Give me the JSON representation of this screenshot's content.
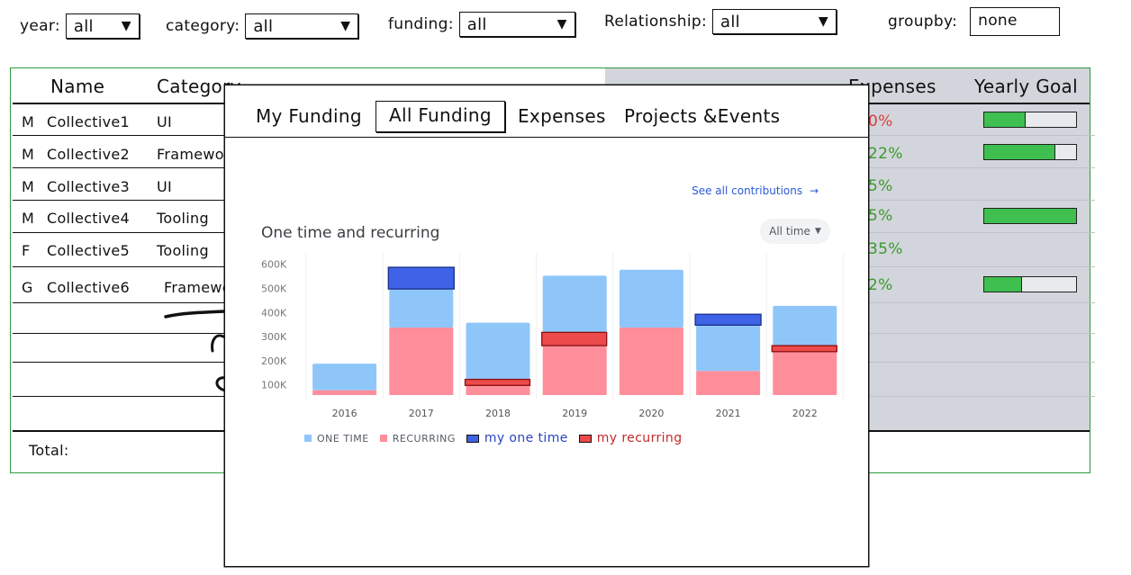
{
  "filters": [
    {
      "label": "year:",
      "value": "all"
    },
    {
      "label": "category:",
      "value": "all"
    },
    {
      "label": "funding:",
      "value": "all"
    },
    {
      "label": "Relationship:",
      "value": "all"
    }
  ],
  "groupby": {
    "label": "groupby:",
    "value": "none"
  },
  "table": {
    "headers": {
      "name": "Name",
      "category": "Category",
      "expenses": "Expenses",
      "yearly_goal": "Yearly Goal"
    },
    "rows": [
      {
        "prefix": "M",
        "name": "Collective1",
        "category": "UI",
        "expenses_pct": "0%",
        "goal": 0.45
      },
      {
        "prefix": "M",
        "name": "Collective2",
        "category": "Framework",
        "expenses_pct": "22%",
        "goal": 0.77
      },
      {
        "prefix": "M",
        "name": "Collective3",
        "category": "UI",
        "expenses_pct": "5%",
        "goal": null
      },
      {
        "prefix": "M",
        "name": "Collective4",
        "category": "Tooling",
        "expenses_pct": "5%",
        "goal": 1.0
      },
      {
        "prefix": "F",
        "name": "Collective5",
        "category": "Tooling",
        "expenses_pct": "35%",
        "goal": null
      },
      {
        "prefix": "G",
        "name": "Collective6",
        "category": "Framework",
        "expenses_pct": "2%",
        "goal": 0.41
      }
    ],
    "total_label": "Total:"
  },
  "modal": {
    "tabs": [
      "My Funding",
      "All Funding",
      "Expenses",
      "Projects &Events"
    ],
    "active_tab": "All Funding",
    "see_all_link": "See all contributions",
    "chart_title": "One time and recurring",
    "time_filter": "All time"
  },
  "colors": {
    "one_time": "#8fc6fa",
    "recurring": "#ff8e9b",
    "my_one_time": "#3f63e6",
    "my_recurring": "#ec4a4a",
    "progress": "#3fbf4f",
    "link": "#2b5bd6",
    "red_pct": "#e03a3a",
    "green_pct": "#3a9a2a"
  },
  "chart_data": {
    "type": "bar",
    "title": "One time and recurring",
    "categories": [
      "2016",
      "2017",
      "2018",
      "2019",
      "2020",
      "2021",
      "2022"
    ],
    "y_ticks": [
      "100K",
      "200K",
      "300K",
      "400K",
      "500K",
      "600K"
    ],
    "ylim": [
      50000,
      610000
    ],
    "series": [
      {
        "name": "ONE TIME",
        "values": [
          110000,
          160000,
          235000,
          235000,
          240000,
          235000,
          165000
        ]
      },
      {
        "name": "RECURRING",
        "values": [
          20000,
          280000,
          65000,
          260000,
          280000,
          100000,
          205000
        ]
      },
      {
        "name": "my one time",
        "values": [
          0,
          90000,
          0,
          0,
          0,
          45000,
          0
        ]
      },
      {
        "name": "my recurring",
        "values": [
          0,
          0,
          25000,
          55000,
          0,
          0,
          25000
        ]
      }
    ],
    "legend_position": "bottom-left",
    "grid": "vertical"
  }
}
